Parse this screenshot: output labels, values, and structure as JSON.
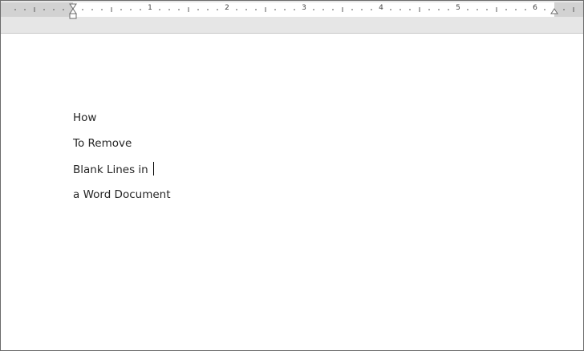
{
  "ruler": {
    "numbers": [
      "1",
      "2",
      "3",
      "4",
      "5",
      "6"
    ]
  },
  "document": {
    "paragraphs": [
      "How",
      "To Remove",
      "Blank Lines in ",
      "a Word Document"
    ]
  },
  "colors": {
    "ruler_band": "#e6e6e6",
    "text": "#262626"
  }
}
